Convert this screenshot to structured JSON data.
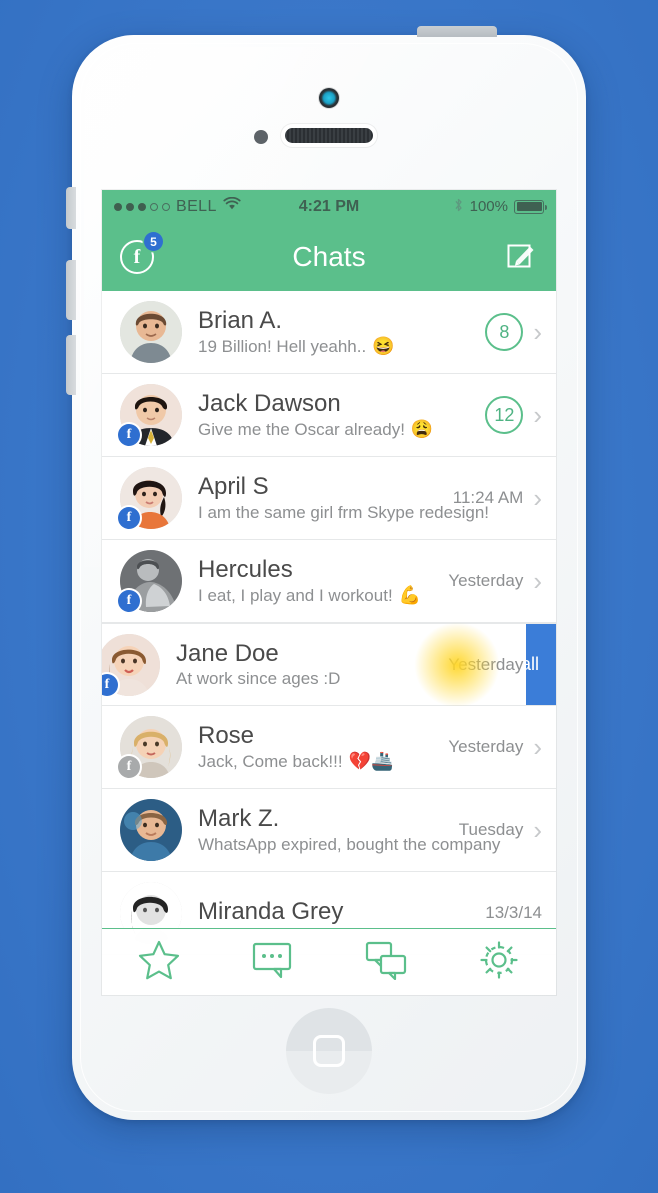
{
  "device": {
    "name": "iphone-5s-white-mockup",
    "frame_color": "#f2f4f6",
    "background_color": "#3a77c9"
  },
  "status_bar": {
    "signal_dots_filled": 3,
    "signal_dots_total": 5,
    "carrier": "BELL",
    "wifi_icon": "wifi-icon",
    "time": "4:21 PM",
    "bluetooth_icon": "bluetooth-icon",
    "battery_percent": "100%",
    "battery_level": 100
  },
  "nav_bar": {
    "title": "Chats",
    "facebook_icon": "facebook-icon",
    "facebook_letter": "f",
    "facebook_badge_count": "5",
    "compose_icon": "compose-pencil-icon",
    "background_color": "#5bbf8b"
  },
  "accent_colors": {
    "green": "#5bbf8b",
    "badge_blue": "#2f6fd0",
    "action_blue": "#3b7dd8",
    "text_dark": "#4a4a4a",
    "text_muted": "#8d8f91"
  },
  "chats": [
    {
      "name": "Brian A.",
      "message": "19 Billion! Hell yeahh..",
      "emoji": "😆",
      "unread": "8",
      "time": "",
      "fb_badge": false,
      "fb_badge_gray": false,
      "swiped": false
    },
    {
      "name": "Jack Dawson",
      "message": "Give me the Oscar already!",
      "emoji": "😩",
      "unread": "12",
      "time": "",
      "fb_badge": true,
      "fb_badge_gray": false,
      "swiped": false
    },
    {
      "name": "April S",
      "message": "I am the same girl frm Skype redesign!",
      "emoji": "",
      "unread": "",
      "time": "11:24 AM",
      "fb_badge": true,
      "fb_badge_gray": false,
      "swiped": false
    },
    {
      "name": "Hercules",
      "message": "I eat, I play and I workout!",
      "emoji": "💪",
      "unread": "",
      "time": "Yesterday",
      "fb_badge": true,
      "fb_badge_gray": false,
      "swiped": false
    },
    {
      "name": "Jane Doe",
      "message": "At work since ages :D",
      "emoji": "",
      "unread": "",
      "time": "Yesterday",
      "fb_badge": true,
      "fb_badge_gray": false,
      "swiped": true,
      "swipe_action_label": "Call"
    },
    {
      "name": "Rose",
      "message": "Jack, Come back!!!",
      "emoji": "💔🚢",
      "unread": "",
      "time": "Yesterday",
      "fb_badge": true,
      "fb_badge_gray": true,
      "swiped": false
    },
    {
      "name": "Mark Z.",
      "message": "WhatsApp expired, bought the company",
      "emoji": "",
      "unread": "",
      "time": "Tuesday",
      "fb_badge": false,
      "fb_badge_gray": false,
      "swiped": false
    },
    {
      "name": "Miranda Grey",
      "message": "",
      "emoji": "",
      "unread": "",
      "time": "13/3/14",
      "fb_badge": false,
      "fb_badge_gray": false,
      "swiped": false
    }
  ],
  "tab_bar": {
    "tabs": [
      {
        "icon": "star-icon",
        "label": "Favorites"
      },
      {
        "icon": "message-dots-icon",
        "label": "Messages"
      },
      {
        "icon": "chats-double-bubble-icon",
        "label": "Chats"
      },
      {
        "icon": "gear-icon",
        "label": "Settings"
      }
    ]
  }
}
